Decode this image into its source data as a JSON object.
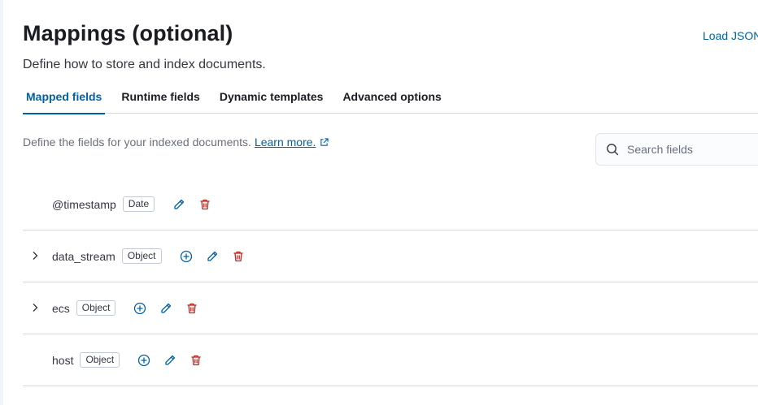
{
  "header": {
    "title": "Mappings (optional)",
    "subtitle": "Define how to store and index documents.",
    "load_json": "Load JSON"
  },
  "tabs": [
    {
      "label": "Mapped fields",
      "active": true
    },
    {
      "label": "Runtime fields",
      "active": false
    },
    {
      "label": "Dynamic templates",
      "active": false
    },
    {
      "label": "Advanced options",
      "active": false
    }
  ],
  "description": {
    "text": "Define the fields for your indexed documents.",
    "link": "Learn more."
  },
  "search": {
    "placeholder": "Search fields"
  },
  "fields": [
    {
      "name": "@timestamp",
      "type": "Date"
    },
    {
      "name": "data_stream",
      "type": "Object"
    },
    {
      "name": "ecs",
      "type": "Object"
    },
    {
      "name": "host",
      "type": "Object"
    }
  ],
  "colors": {
    "accent": "#0061a6",
    "danger": "#bd271e",
    "text": "#1a1c21"
  },
  "icons": {
    "add": "plus-in-circle-icon",
    "edit": "pencil-icon",
    "delete": "trash-icon",
    "expand": "chevron-right-icon",
    "search": "search-icon",
    "external": "external-link-icon"
  }
}
